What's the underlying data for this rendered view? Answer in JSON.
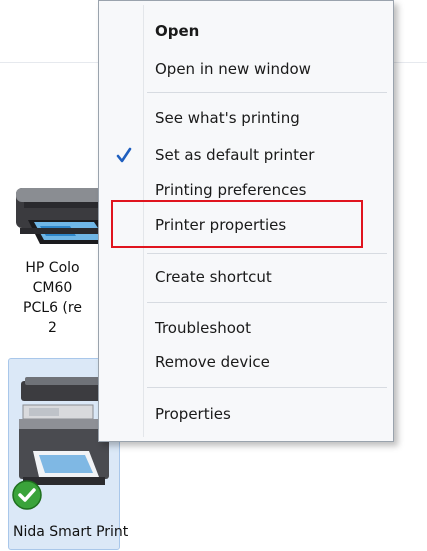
{
  "desktop": {
    "printer1": {
      "label_lines": [
        "HP Colo",
        "CM60",
        "PCL6 (re",
        "2"
      ]
    },
    "printer2": {
      "label": "Nida Smart Print",
      "status": "default"
    }
  },
  "context_menu": {
    "items": [
      {
        "label": "Open",
        "bold": true
      },
      {
        "label": "Open in new window"
      },
      {
        "label": "See what's printing"
      },
      {
        "label": "Set as default printer",
        "checked": true
      },
      {
        "label": "Printing preferences"
      },
      {
        "label": "Printer properties",
        "highlighted": true
      },
      {
        "label": "Create shortcut"
      },
      {
        "label": "Troubleshoot"
      },
      {
        "label": "Remove device"
      },
      {
        "label": "Properties"
      }
    ]
  },
  "colors": {
    "highlight": "#e0141e",
    "check": "#1f5fbf",
    "selection": "#dbe8f7"
  }
}
